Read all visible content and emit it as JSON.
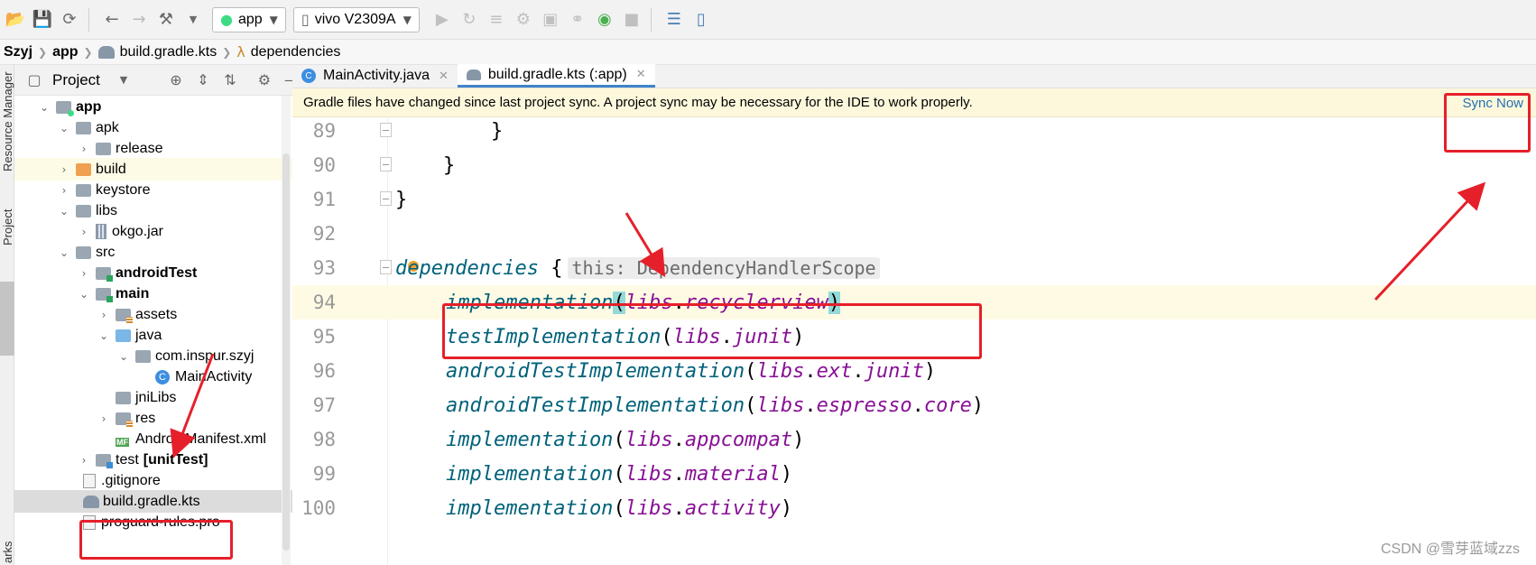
{
  "toolbar": {
    "run_config": "app",
    "device": "vivo V2309A",
    "icons": [
      "open-icon",
      "save-icon",
      "sync-icon",
      "back-icon",
      "forward-icon",
      "build-icon",
      "run-icon",
      "rerun-icon",
      "debug-icon",
      "profile-icon",
      "attach-icon",
      "apply-changes-icon",
      "stop-icon",
      "gradle-sync-icon",
      "device-manager-icon"
    ]
  },
  "breadcrumb": {
    "items": [
      "Szyj",
      "app",
      "build.gradle.kts",
      "dependencies"
    ]
  },
  "left_strip": {
    "resource_manager": "Resource Manager",
    "project": "Project",
    "bookmarks": "arks"
  },
  "project_panel": {
    "title": "Project",
    "tree": [
      {
        "label": "app",
        "bold": true
      },
      {
        "label": "apk"
      },
      {
        "label": "release"
      },
      {
        "label": "build"
      },
      {
        "label": "keystore"
      },
      {
        "label": "libs"
      },
      {
        "label": "okgo.jar"
      },
      {
        "label": "src"
      },
      {
        "label": "androidTest",
        "bold": true
      },
      {
        "label": "main",
        "bold": true
      },
      {
        "label": "assets"
      },
      {
        "label": "java"
      },
      {
        "label": "com.inspur.szyj"
      },
      {
        "label": "MainActivity"
      },
      {
        "label": "jniLibs"
      },
      {
        "label": "res"
      },
      {
        "label": "AndroidManifest.xml"
      },
      {
        "label": "test",
        "suffix": "[unitTest]"
      },
      {
        "label": ".gitignore"
      },
      {
        "label": "build.gradle.kts"
      },
      {
        "label": "proguard-rules.pro"
      }
    ]
  },
  "editor": {
    "tabs": [
      {
        "label": "MainActivity.java"
      },
      {
        "label": "build.gradle.kts (:app)"
      }
    ],
    "notice": "Gradle files have changed since last project sync. A project sync may be necessary for the IDE to work properly.",
    "sync_now": "Sync Now",
    "inlay_hint": "this: DependencyHandlerScope",
    "lines": [
      {
        "num": "89",
        "text": "        }"
      },
      {
        "num": "90",
        "text": "    }"
      },
      {
        "num": "91",
        "text": "}"
      },
      {
        "num": "92",
        "text": ""
      },
      {
        "num": "93",
        "kw": "dependencies",
        "rest": " {"
      },
      {
        "num": "94",
        "fn": "implementation",
        "ns": "libs",
        "member": "recyclerview"
      },
      {
        "num": "95",
        "fn": "testImplementation",
        "ns": "libs",
        "member": "junit"
      },
      {
        "num": "96",
        "fn": "androidTestImplementation",
        "ns": "libs",
        "member": "ext",
        "member2": "junit"
      },
      {
        "num": "97",
        "fn": "androidTestImplementation",
        "ns": "libs",
        "member": "espresso",
        "member2": "core"
      },
      {
        "num": "98",
        "fn": "implementation",
        "ns": "libs",
        "member": "appcompat"
      },
      {
        "num": "99",
        "fn": "implementation",
        "ns": "libs",
        "member": "material"
      },
      {
        "num": "100",
        "fn": "implementation",
        "ns": "libs",
        "member": "activity"
      }
    ]
  },
  "watermark": "CSDN @雪芽蓝域zzs",
  "colors": {
    "annotation_red": "#e5202a",
    "function_teal": "#00627a",
    "namespace_purple": "#871094",
    "link_blue": "#2470b3"
  }
}
